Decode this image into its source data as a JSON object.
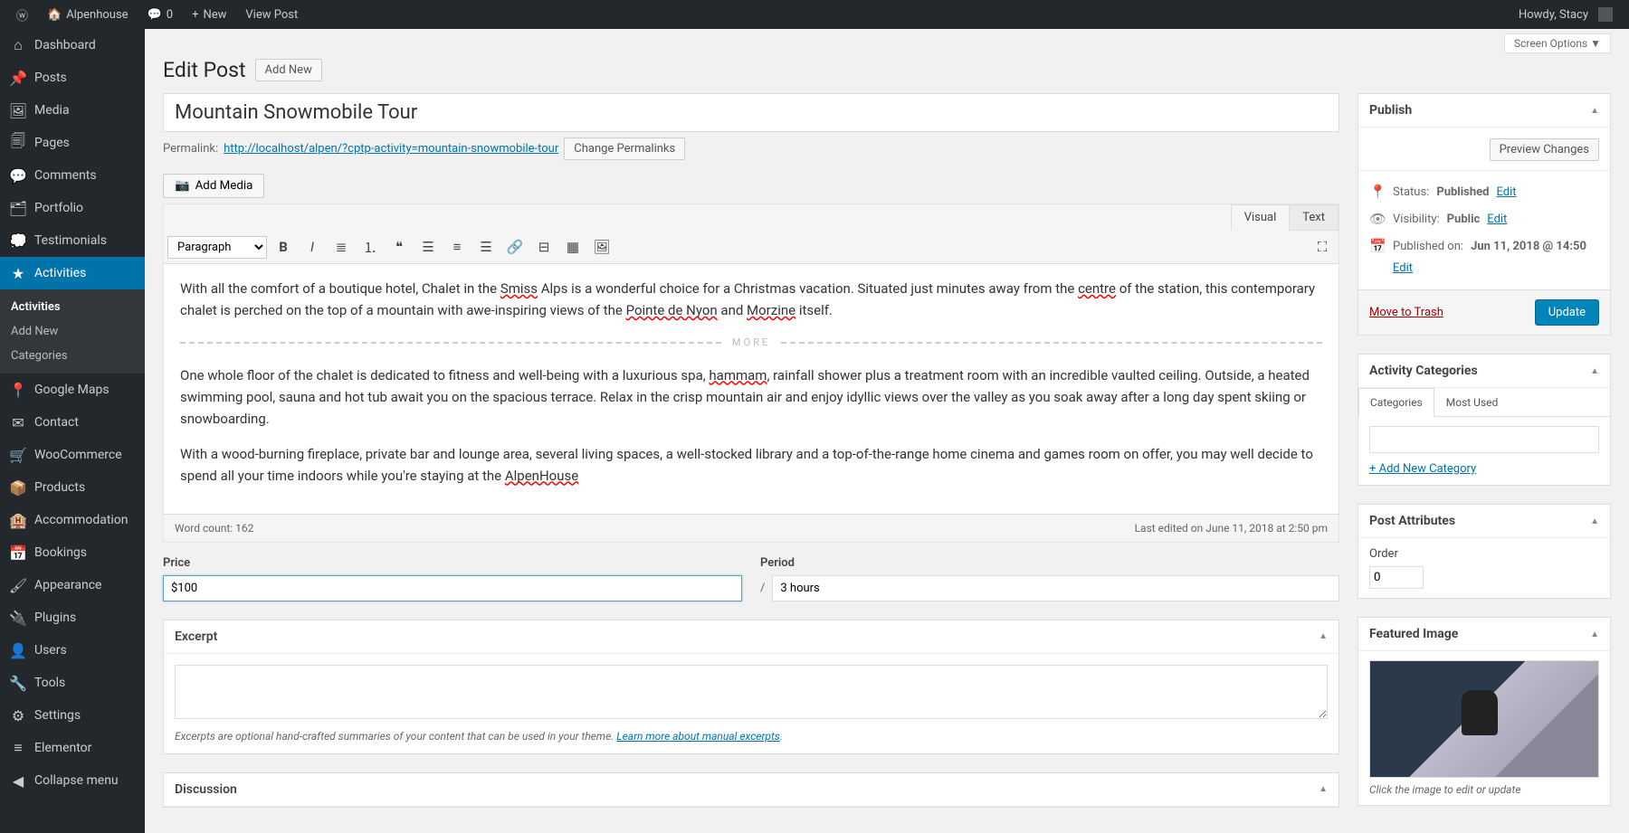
{
  "topbar": {
    "site": "Alpenhouse",
    "comments": "0",
    "new": "New",
    "view": "View Post",
    "greeting": "Howdy, Stacy"
  },
  "sidebar": {
    "items": [
      {
        "label": "Dashboard",
        "icon": "⌂"
      },
      {
        "label": "Posts",
        "icon": "📌"
      },
      {
        "label": "Media",
        "icon": "🖼"
      },
      {
        "label": "Pages",
        "icon": "🗐"
      },
      {
        "label": "Comments",
        "icon": "💬"
      },
      {
        "label": "Portfolio",
        "icon": "🗂"
      },
      {
        "label": "Testimonials",
        "icon": "💭"
      },
      {
        "label": "Activities",
        "icon": "★"
      },
      {
        "label": "Google Maps",
        "icon": "📍"
      },
      {
        "label": "Contact",
        "icon": "✉"
      },
      {
        "label": "WooCommerce",
        "icon": "🛒"
      },
      {
        "label": "Products",
        "icon": "📦"
      },
      {
        "label": "Accommodation",
        "icon": "🏨"
      },
      {
        "label": "Bookings",
        "icon": "📅"
      },
      {
        "label": "Appearance",
        "icon": "🖌"
      },
      {
        "label": "Plugins",
        "icon": "🔌"
      },
      {
        "label": "Users",
        "icon": "👤"
      },
      {
        "label": "Tools",
        "icon": "🔧"
      },
      {
        "label": "Settings",
        "icon": "⚙"
      },
      {
        "label": "Elementor",
        "icon": "≡"
      },
      {
        "label": "Collapse menu",
        "icon": "◀"
      }
    ],
    "submenu": [
      "Activities",
      "Add New",
      "Categories"
    ]
  },
  "screen_options": "Screen Options ▼",
  "page": {
    "title": "Edit Post",
    "add_new": "Add New"
  },
  "post": {
    "title": "Mountain Snowmobile Tour",
    "permalink_label": "Permalink:",
    "permalink_url": "http://localhost/alpen/?cptp-activity=mountain-snowmobile-tour",
    "change_permalinks": "Change Permalinks",
    "add_media": "Add Media",
    "word_count": "Word count: 162",
    "last_edited": "Last edited on June 11, 2018 at 2:50 pm"
  },
  "editor": {
    "tabs": {
      "visual": "Visual",
      "text": "Text"
    },
    "format": "Paragraph",
    "more": "MORE"
  },
  "content": {
    "p1a": "With all the comfort of a boutique hotel, Chalet in the ",
    "smiss": "Smiss",
    "p1b": " Alps is a wonderful choice for a Christmas vacation. Situated just minutes away from the ",
    "centre": "centre",
    "p1c": " of the station, this contemporary chalet is perched on the top of a mountain with awe-inspiring views of the ",
    "pointe": "Pointe de Nyon",
    "p1d": " and ",
    "morzine": "Morzine",
    "p1e": " itself.",
    "p2a": "One whole floor of the chalet is dedicated to fitness and well-being with a luxurious spa, ",
    "hammam": "hammam",
    "p2b": ", rainfall shower plus a treatment room with an incredible vaulted ceiling. Outside, a heated swimming pool, sauna and hot tub await you on the spacious terrace. Relax in the crisp mountain air and enjoy idyllic views over the valley as you soak away after a long day spent skiing or snowboarding.",
    "p3a": "With a wood-burning fireplace, private bar and lounge area, several living spaces, a well-stocked library and a top-of-the-range home cinema and games room on offer, you may well decide to spend all your time indoors while you're staying at the ",
    "alpen": "AlpenHouse"
  },
  "meta": {
    "price_label": "Price",
    "price_value": "$100",
    "period_label": "Period",
    "period_slash": "/",
    "period_value": "3 hours"
  },
  "excerpt": {
    "title": "Excerpt",
    "value": "",
    "hint_a": "Excerpts are optional hand-crafted summaries of your content that can be used in your theme. ",
    "hint_link": "Learn more about manual excerpts",
    "hint_b": "."
  },
  "discussion": {
    "title": "Discussion"
  },
  "publish": {
    "title": "Publish",
    "preview": "Preview Changes",
    "status_label": "Status:",
    "status_value": "Published",
    "visibility_label": "Visibility:",
    "visibility_value": "Public",
    "published_label": "Published on:",
    "published_value": "Jun 11, 2018 @ 14:50",
    "edit": "Edit",
    "trash": "Move to Trash",
    "update": "Update"
  },
  "categories": {
    "title": "Activity Categories",
    "tab_cat": "Categories",
    "tab_most": "Most Used",
    "add_new": "+ Add New Category"
  },
  "attributes": {
    "title": "Post Attributes",
    "order_label": "Order",
    "order_value": "0"
  },
  "featured": {
    "title": "Featured Image",
    "caption": "Click the image to edit or update"
  }
}
